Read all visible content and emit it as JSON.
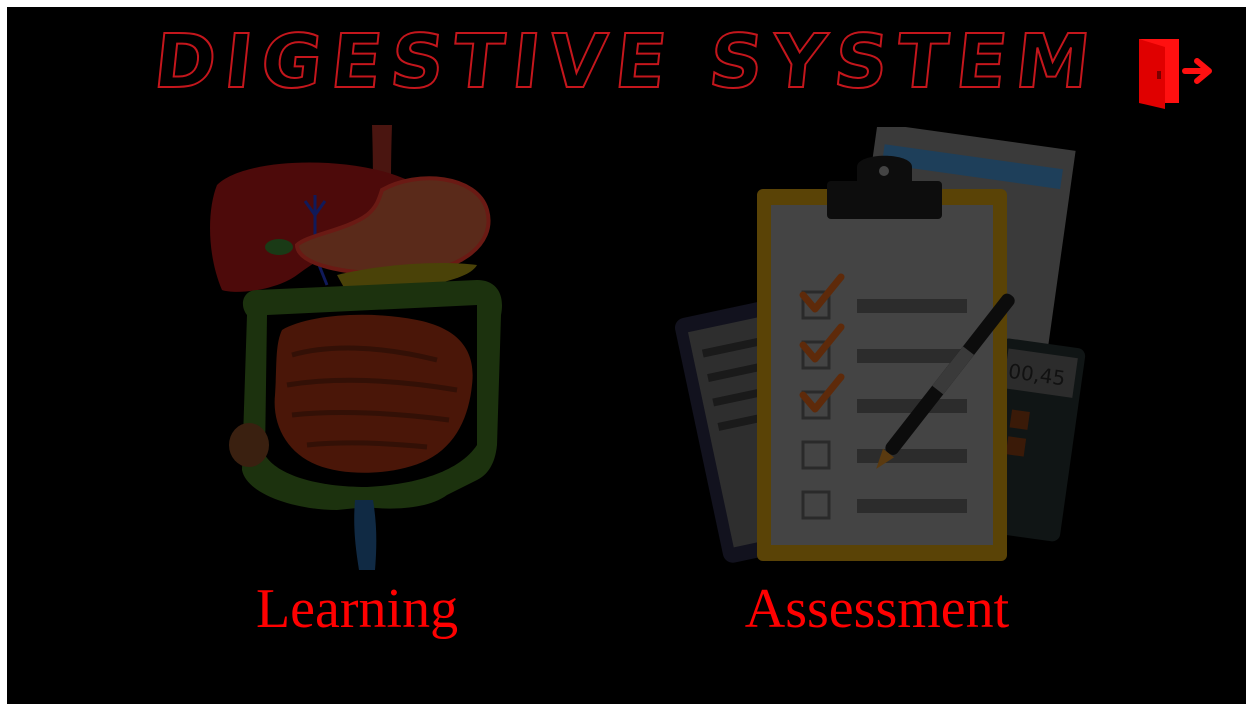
{
  "screen": {
    "title": "DIGESTIVE SYSTEM",
    "exit_icon": "exit-door-icon"
  },
  "menu": {
    "learning": {
      "label": "Learning",
      "icon": "digestive-system-illustration"
    },
    "assessment": {
      "label": "Assessment",
      "icon": "clipboard-checklist-illustration",
      "calculator_readout": "00,45"
    }
  },
  "colors": {
    "background": "#000000",
    "frame": "#ffffff",
    "accent": "#ff0000",
    "title_outline": "#c4161c"
  }
}
